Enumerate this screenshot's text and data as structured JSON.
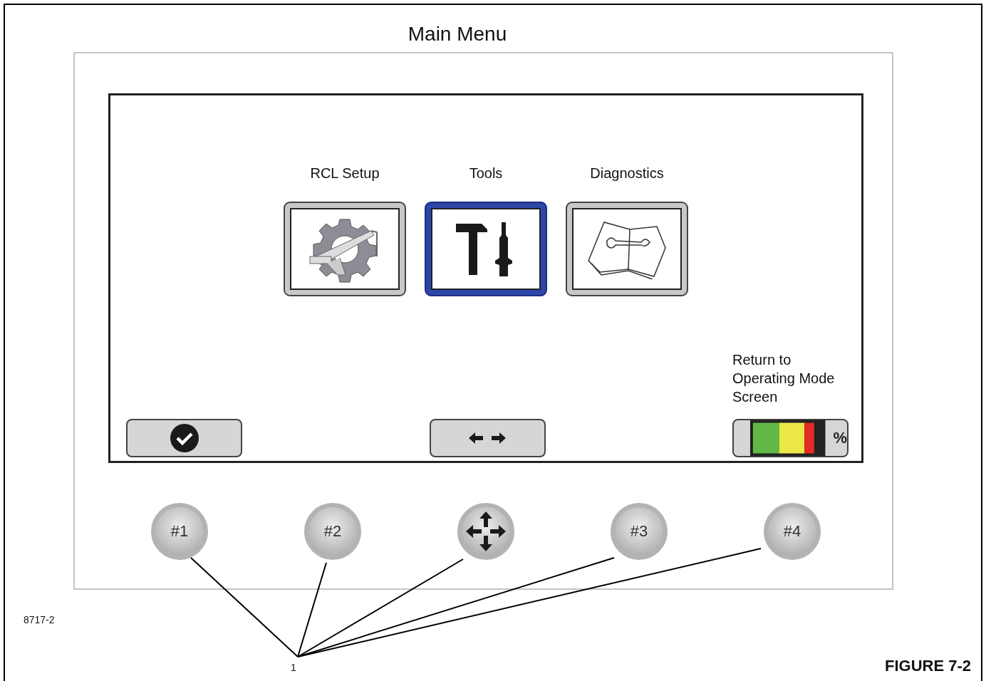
{
  "title": "Main Menu",
  "menu_items": [
    {
      "label": "RCL Setup",
      "kind": "gear",
      "selected": false
    },
    {
      "label": "Tools",
      "kind": "tools",
      "selected": true
    },
    {
      "label": "Diagnostics",
      "kind": "book",
      "selected": false
    }
  ],
  "soft_keys": [
    {
      "kind": "check"
    },
    {
      "kind": "arrows"
    },
    {
      "kind": "gauge",
      "caption": "Return to Operating Mode Screen",
      "symbol": "%"
    }
  ],
  "hardware_buttons": [
    {
      "kind": "label",
      "label": "#1"
    },
    {
      "kind": "label",
      "label": "#2"
    },
    {
      "kind": "arrows"
    },
    {
      "kind": "label",
      "label": "#3"
    },
    {
      "kind": "label",
      "label": "#4"
    }
  ],
  "callout": "1",
  "figure_code": "8717-2",
  "figure_caption": "FIGURE 7-2"
}
